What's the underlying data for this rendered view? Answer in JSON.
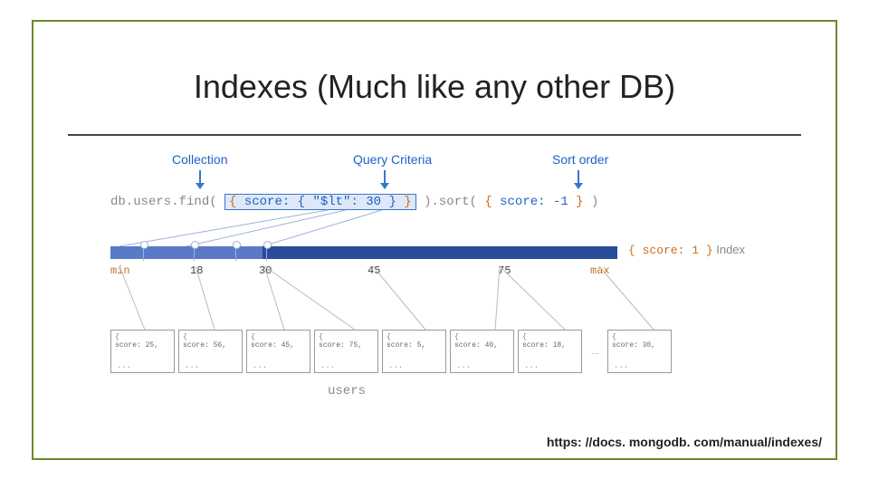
{
  "title": "Indexes (Much like any other DB)",
  "footer_url": "https: //docs. mongodb. com/manual/indexes/",
  "labels": {
    "collection": "Collection",
    "query_criteria": "Query Criteria",
    "sort_order": "Sort order"
  },
  "query": {
    "prefix": "db.users.find( ",
    "criteria_open": "{",
    "criteria_inner": " score: { \"$lt\": 30 } ",
    "criteria_close": "}",
    "mid": " ).sort( ",
    "sort_open": "{",
    "sort_inner": " score: -1 ",
    "sort_close": "}",
    "suffix": " )"
  },
  "index_annotation": {
    "spec": "{ score: 1 }",
    "word": " Index"
  },
  "scale": {
    "min": "min",
    "v1": "18",
    "v2": "30",
    "v3": "45",
    "v4": "75",
    "max": "max"
  },
  "documents": [
    {
      "text": "score: 25,"
    },
    {
      "text": "score: 56,"
    },
    {
      "text": "score: 45,"
    },
    {
      "text": "score: 75,"
    },
    {
      "text": "score: 5,"
    },
    {
      "text": "score: 40,"
    },
    {
      "text": "score: 18,"
    },
    {
      "text": "score: 30,"
    }
  ],
  "users_label": "users",
  "gap_ellipsis": "..."
}
